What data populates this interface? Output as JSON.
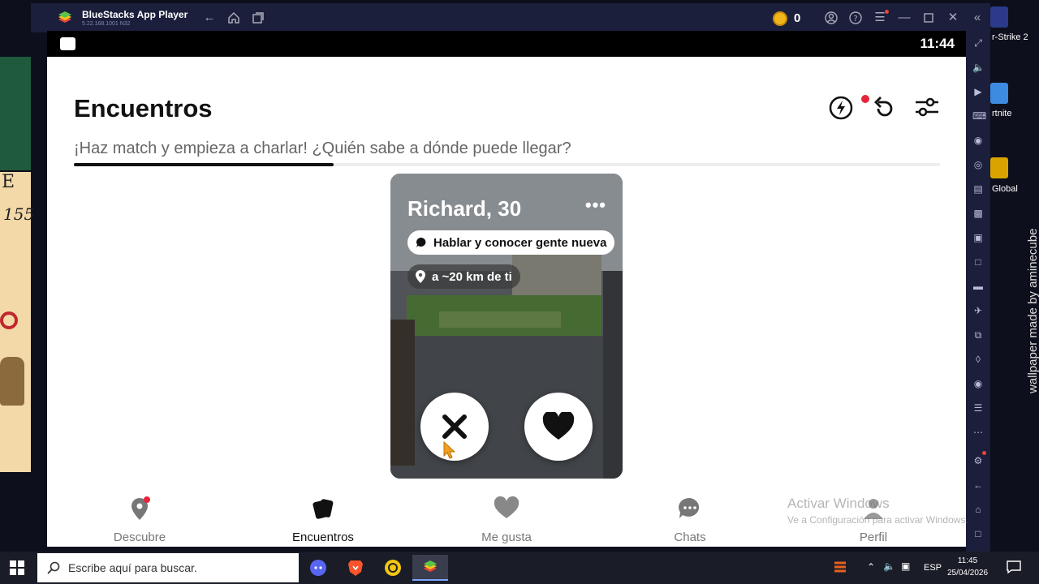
{
  "window": {
    "app_name": "BlueStacks App Player",
    "app_version": "5.22.168.1001 N32",
    "coins": "0"
  },
  "android_status": {
    "time": "11:44"
  },
  "app": {
    "title": "Encuentros",
    "subtitle": "¡Haz match y empieza a charlar! ¿Quién sabe a dónde puede llegar?",
    "progress": 0.3,
    "card": {
      "name_age": "Richard, 30",
      "more": "•••",
      "intent": "Hablar y conocer gente nueva",
      "distance": "a ~20 km de ti"
    },
    "nav": [
      {
        "label": "Descubre",
        "icon": "location-pin-icon"
      },
      {
        "label": "Encuentros",
        "icon": "cards-icon",
        "active": true
      },
      {
        "label": "Me gusta",
        "icon": "heart-icon"
      },
      {
        "label": "Chats",
        "icon": "chat-bubble-icon"
      },
      {
        "label": "Perfil",
        "icon": "profile-icon"
      }
    ]
  },
  "watermark": {
    "title": "Activar Windows",
    "subtitle": "Ve a Configuración para activar Windows."
  },
  "desktop": {
    "labels": [
      "r-Strike 2",
      "rtnite",
      "Global"
    ],
    "wallpaper_credit": "wallpaper made by aminecube",
    "poster_text": [
      "E",
      "155"
    ]
  },
  "taskbar": {
    "search_placeholder": "Escribe aquí para buscar.",
    "language": "ESP",
    "time": "11:45",
    "date": "25/04/2026"
  },
  "colors": {
    "bluestacks_chrome": "#1b1f3b",
    "accent_red": "#e8233a",
    "coin": "#f0b51a"
  }
}
